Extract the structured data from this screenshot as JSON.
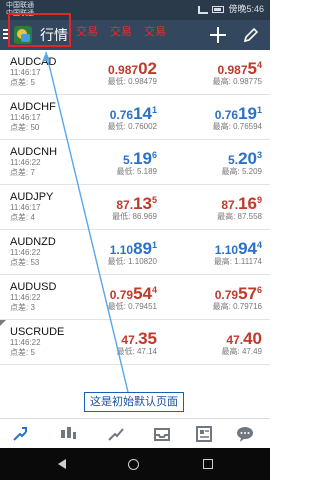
{
  "status_bar": {
    "carrier": "中国联通",
    "carrier_sub": "中国联通",
    "time": "傍晚5:46"
  },
  "app_bar": {
    "title": "行情",
    "overlay_marks": [
      "交易",
      "交易",
      "交易"
    ]
  },
  "quotes": [
    {
      "symbol": "AUDCAD",
      "time": "11:46:17",
      "spread": "点差: 5",
      "bid_main": "0.987",
      "bid_big": "02",
      "bid_sup": "",
      "ask_main": "0.987",
      "ask_big": "5",
      "ask_sup": "4",
      "low": "最低: 0.98479",
      "high": "最高: 0.98775",
      "bid_color": "red",
      "ask_color": "red"
    },
    {
      "symbol": "AUDCHF",
      "time": "11:46:17",
      "spread": "点差: 50",
      "bid_main": "0.76",
      "bid_big": "14",
      "bid_sup": "1",
      "ask_main": "0.76",
      "ask_big": "19",
      "ask_sup": "1",
      "low": "最低: 0.76002",
      "high": "最高: 0.76594",
      "bid_color": "blue",
      "ask_color": "blue"
    },
    {
      "symbol": "AUDCNH",
      "time": "11:46:22",
      "spread": "点差: 7",
      "bid_main": "5.",
      "bid_big": "19",
      "bid_sup": "6",
      "ask_main": "5.",
      "ask_big": "20",
      "ask_sup": "3",
      "low": "最低: 5.189",
      "high": "最高: 5.209",
      "bid_color": "blue",
      "ask_color": "blue"
    },
    {
      "symbol": "AUDJPY",
      "time": "11:46:17",
      "spread": "点差: 4",
      "bid_main": "87.",
      "bid_big": "13",
      "bid_sup": "5",
      "ask_main": "87.",
      "ask_big": "16",
      "ask_sup": "9",
      "low": "最低: 86.969",
      "high": "最高: 87.558",
      "bid_color": "red",
      "ask_color": "red"
    },
    {
      "symbol": "AUDNZD",
      "time": "11:46:22",
      "spread": "点差: 53",
      "bid_main": "1.10",
      "bid_big": "89",
      "bid_sup": "1",
      "ask_main": "1.10",
      "ask_big": "94",
      "ask_sup": "4",
      "low": "最低: 1.10820",
      "high": "最高: 1.11174",
      "bid_color": "blue",
      "ask_color": "blue"
    },
    {
      "symbol": "AUDUSD",
      "time": "11:46:22",
      "spread": "点差: 3",
      "bid_main": "0.79",
      "bid_big": "54",
      "bid_sup": "4",
      "ask_main": "0.79",
      "ask_big": "57",
      "ask_sup": "6",
      "low": "最低: 0.79451",
      "high": "最高: 0.79716",
      "bid_color": "red",
      "ask_color": "red"
    },
    {
      "symbol": "USCRUDE",
      "time": "11:46:22",
      "spread": "点差: 5",
      "bid_main": "47.",
      "bid_big": "35",
      "bid_sup": "",
      "ask_main": "47.",
      "ask_big": "40",
      "ask_sup": "",
      "low": "最低: 47.14",
      "high": "最高: 47.49",
      "bid_color": "red",
      "ask_color": "red"
    }
  ],
  "callout": {
    "text": "这是初始默认页面"
  },
  "bottom_nav": [
    "quotes-icon",
    "chart-icon",
    "trade-icon",
    "history-icon",
    "news-icon",
    "chat-icon"
  ],
  "colors": {
    "app_bar": "#33485e",
    "highlight": "#e0262b",
    "up": "#2b71c6",
    "down": "#c0392b"
  }
}
